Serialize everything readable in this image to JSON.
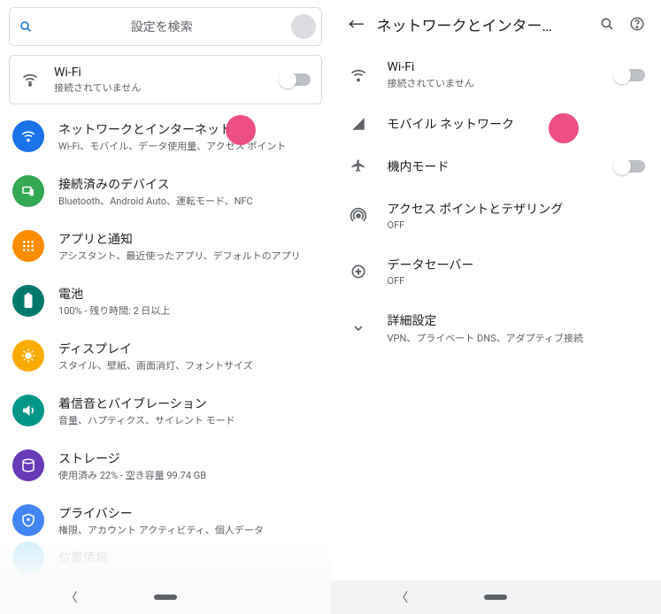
{
  "left": {
    "search_placeholder": "設定を検索",
    "wifi": {
      "title": "Wi-Fi",
      "subtitle": "接続されていません"
    },
    "items": [
      {
        "title": "ネットワークとインターネット",
        "subtitle": "Wi-Fi、モバイル、データ使用量、アクセス ポイント"
      },
      {
        "title": "接続済みのデバイス",
        "subtitle": "Bluetooth、Android Auto、運転モード、NFC"
      },
      {
        "title": "アプリと通知",
        "subtitle": "アシスタント、最近使ったアプリ、デフォルトのアプリ"
      },
      {
        "title": "電池",
        "subtitle": "100% - 残り時間: 2 日以上"
      },
      {
        "title": "ディスプレイ",
        "subtitle": "スタイル、壁紙、画面消灯、フォントサイズ"
      },
      {
        "title": "着信音とバイブレーション",
        "subtitle": "音量、ハプティクス、サイレント モード"
      },
      {
        "title": "ストレージ",
        "subtitle": "使用済み 22% - 空き容量 99.74 GB"
      },
      {
        "title": "プライバシー",
        "subtitle": "権限、アカウント アクティビティ、個人データ"
      }
    ],
    "ghost": "位置情報"
  },
  "right": {
    "title": "ネットワークとインター…",
    "items": [
      {
        "title": "Wi-Fi",
        "subtitle": "接続されていません",
        "toggle": true
      },
      {
        "title": "モバイル ネットワーク",
        "subtitle": ""
      },
      {
        "title": "機内モード",
        "subtitle": "",
        "toggle": true
      },
      {
        "title": "アクセス ポイントとテザリング",
        "subtitle": "OFF"
      },
      {
        "title": "データセーバー",
        "subtitle": "OFF"
      },
      {
        "title": "詳細設定",
        "subtitle": "VPN、プライベート DNS、アダプティブ接続"
      }
    ]
  }
}
